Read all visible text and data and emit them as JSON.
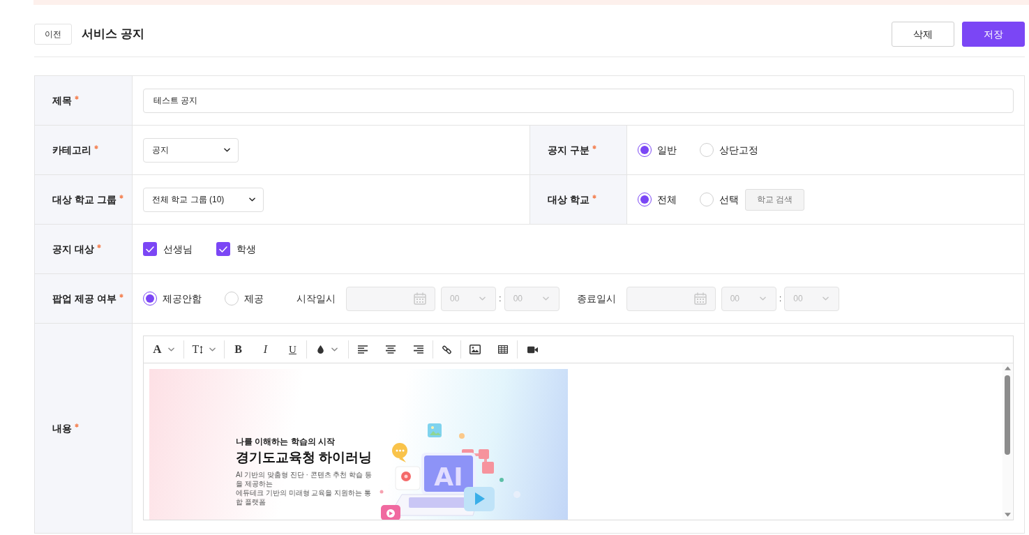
{
  "header": {
    "back_button": "이전",
    "title": "서비스 공지",
    "buttons": [
      {
        "label": "삭제",
        "kind": "secondary"
      },
      {
        "label": "저장",
        "kind": "primary"
      }
    ]
  },
  "form": {
    "rows": [
      {
        "fields": [
          {
            "label": "제목",
            "required": true,
            "control": {
              "kind": "text",
              "value": "테스트 공지"
            }
          }
        ]
      },
      {
        "fields": [
          {
            "label": "카테고리",
            "required": true,
            "control": {
              "kind": "select",
              "value": "공지"
            }
          },
          {
            "label": "공지 구분",
            "required": true,
            "control": {
              "kind": "radio",
              "options": [
                {
                  "label": "일반",
                  "selected": true
                },
                {
                  "label": "상단고정",
                  "selected": false
                }
              ]
            }
          }
        ]
      },
      {
        "fields": [
          {
            "label": "대상 학교 그룹",
            "required": true,
            "control": {
              "kind": "select",
              "value": "전체 학교 그룹 (10)"
            }
          },
          {
            "label": "대상 학교",
            "required": true,
            "control": {
              "kind": "radio",
              "options": [
                {
                  "label": "전체",
                  "selected": true
                },
                {
                  "label": "선택",
                  "selected": false
                }
              ],
              "button": "학교 검색"
            }
          }
        ]
      },
      {
        "fields": [
          {
            "label": "공지 대상",
            "required": true,
            "control": {
              "kind": "checkbox",
              "options": [
                {
                  "label": "선생님",
                  "checked": true
                },
                {
                  "label": "학생",
                  "checked": true
                }
              ]
            }
          }
        ]
      },
      {
        "fields": [
          {
            "label": "팝업 제공 여부",
            "required": true,
            "control": {
              "kind": "popup",
              "options": [
                {
                  "label": "제공안함",
                  "selected": true
                },
                {
                  "label": "제공",
                  "selected": false
                }
              ],
              "periods": [
                {
                  "label": "시작일시",
                  "disabled": true,
                  "hour": "00",
                  "separator": ":",
                  "minute": "00"
                },
                {
                  "label": "종료일시",
                  "disabled": true,
                  "hour": "00",
                  "separator": ":",
                  "minute": "00"
                }
              ]
            }
          }
        ]
      },
      {
        "fields": [
          {
            "label": "내용",
            "required": true,
            "control": {
              "kind": "editor",
              "toolbar": [
                {
                  "kind": "font",
                  "label": "A"
                },
                {
                  "kind": "size",
                  "label": "T"
                },
                {
                  "kind": "bold",
                  "label": "B"
                },
                {
                  "kind": "italic",
                  "label": "I"
                },
                {
                  "kind": "underline",
                  "label": "U"
                }
              ],
              "image": {
                "subtitle": "나를 이해하는 학습의 시작",
                "title": "경기도교육청 하이러닝",
                "description": [
                  "AI 기반의 맞춤형 진단 · 콘텐츠 추천 학습 등을 제공하는",
                  "에듀테크 기반의 미래형 교육을 지원하는 통합 플랫폼"
                ],
                "screen_text": "AI"
              }
            }
          }
        ]
      }
    ]
  }
}
